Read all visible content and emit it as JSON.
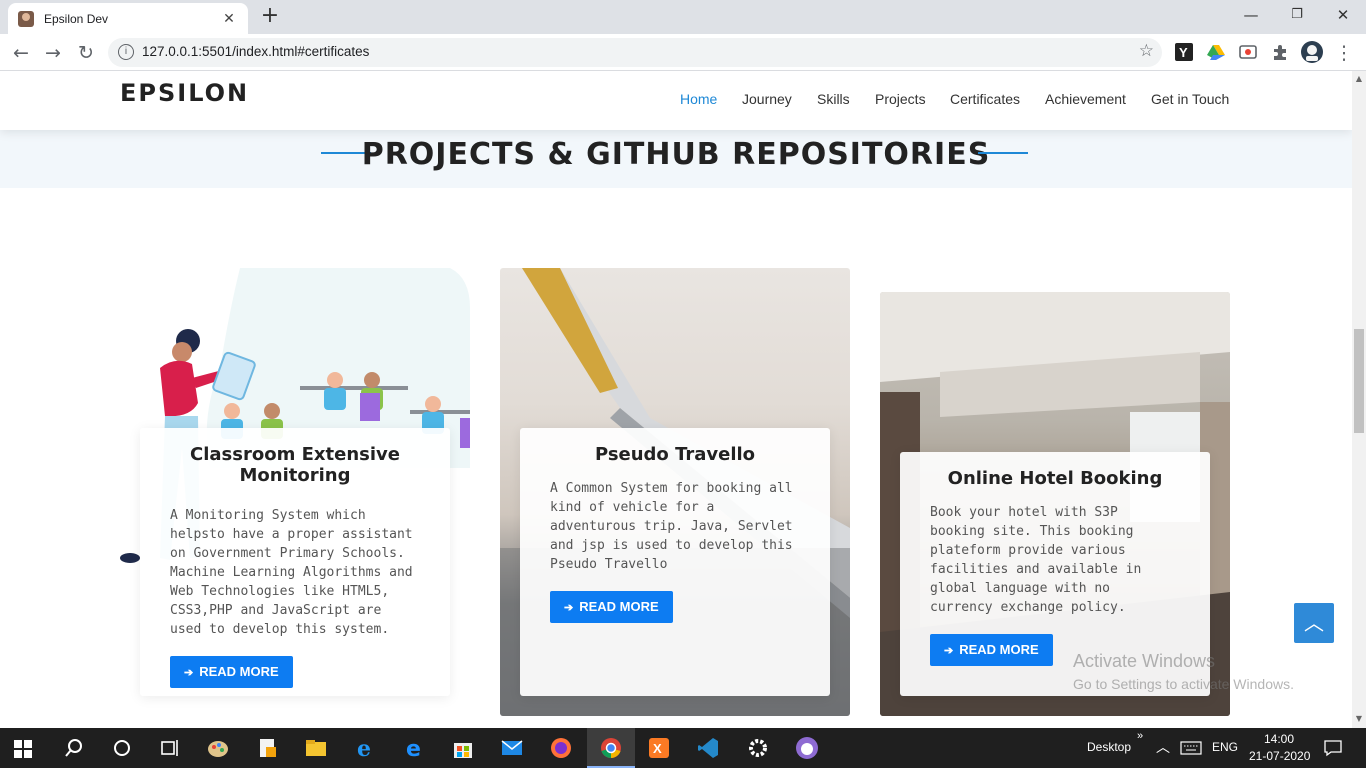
{
  "browser": {
    "tab_title": "Epsilon Dev",
    "tab_close": "✕",
    "new_tab": "+",
    "url": "127.0.0.1:5501/index.html#certificates",
    "window_controls": [
      "—",
      "❐",
      "✕"
    ]
  },
  "site": {
    "logo": "EPSILON",
    "nav": [
      "Home",
      "Journey",
      "Skills",
      "Projects",
      "Certificates",
      "Achievement",
      "Get in Touch"
    ],
    "active_nav": "Home",
    "accent_color": "#1e88d6",
    "button_color": "#0d7cf2"
  },
  "section": {
    "title": "PROJECTS & GITHUB REPOSITORIES"
  },
  "projects": [
    {
      "title": "Classroom Extensive Monitoring",
      "description": "A Monitoring System which helpsto have a proper assistant on Government Primary Schools. Machine Learning Algorithms and Web Technologies like HTML5, CSS3,PHP and JavaScript are used to develop this system.",
      "button": "READ MORE"
    },
    {
      "title": "Pseudo Travello",
      "description": "A Common System for booking all kind of vehicle for a adventurous trip. Java, Servlet and jsp is used to develop this Pseudo Travello",
      "button": "READ MORE"
    },
    {
      "title": "Online Hotel Booking",
      "description": "Book your hotel with S3P booking site. This booking plateform provide various facilities and available in global language with no currency exchange policy.",
      "button": "READ MORE"
    }
  ],
  "overlay": {
    "activate_title": "Activate Windows",
    "activate_sub": "Go to Settings to activate Windows."
  },
  "taskbar": {
    "desktop_label": "Desktop",
    "chevron": "»",
    "language": "ENG",
    "time": "14:00",
    "date": "21-07-2020"
  }
}
